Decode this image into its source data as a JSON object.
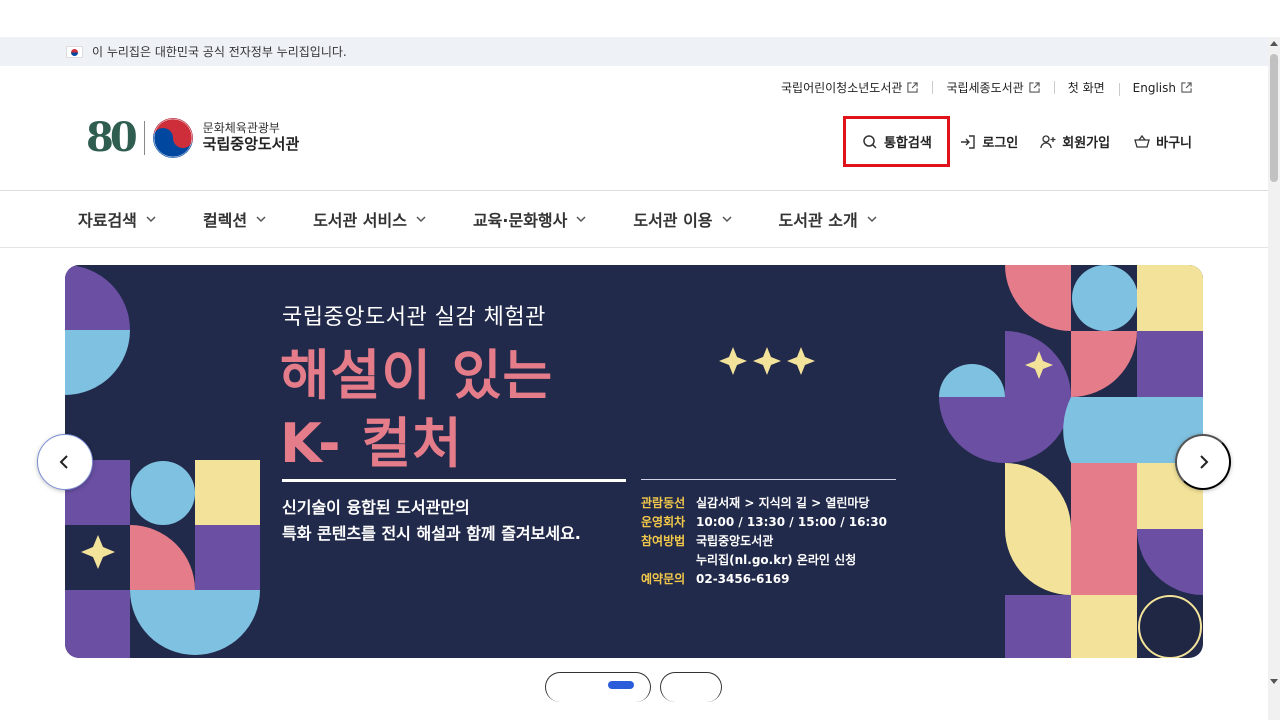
{
  "gov_banner": {
    "text": "이 누리집은 대한민국 공식 전자정부 누리집입니다."
  },
  "util_links": [
    {
      "label": "국립어린이청소년도서관"
    },
    {
      "label": "국립세종도서관"
    },
    {
      "label": "첫 화면"
    },
    {
      "label": "English"
    }
  ],
  "logo": {
    "number": "80",
    "ministry": "문화체육관광부",
    "library": "국립중앙도서관"
  },
  "actions": {
    "search": "통합검색",
    "login": "로그인",
    "signup": "회원가입",
    "cart": "바구니"
  },
  "gnb": [
    {
      "label": "자료검색"
    },
    {
      "label": "컬렉션"
    },
    {
      "label": "도서관 서비스"
    },
    {
      "label": "교육·문화행사"
    },
    {
      "label": "도서관 이용"
    },
    {
      "label": "도서관 소개"
    }
  ],
  "banner": {
    "subtitle": "국립중앙도서관 실감 체험관",
    "title_line1": "해설이 있는",
    "title_line2": "K- 컬처",
    "desc_line1": "신기술이 융합된 도서관만의",
    "desc_line2": "특화 콘텐츠를 전시 해설과 함께 즐겨보세요.",
    "info": [
      {
        "key": "관람동선",
        "value": "실감서재 > 지식의 길 > 열린마당"
      },
      {
        "key": "운영회차",
        "value": "10:00 / 13:30 / 15:00 / 16:30"
      },
      {
        "key": "참여방법",
        "value": "국립중앙도서관"
      },
      {
        "key": "",
        "value": "누리집(nl.go.kr) 온라인 신청"
      },
      {
        "key": "예약문의",
        "value": "02-3456-6169"
      }
    ]
  },
  "colors": {
    "highlight": "#e0131b",
    "banner_bg": "#222a4b",
    "title_pink": "#e47c8a",
    "info_yellow": "#f2c84b",
    "pager_active": "#2b5cd9"
  }
}
